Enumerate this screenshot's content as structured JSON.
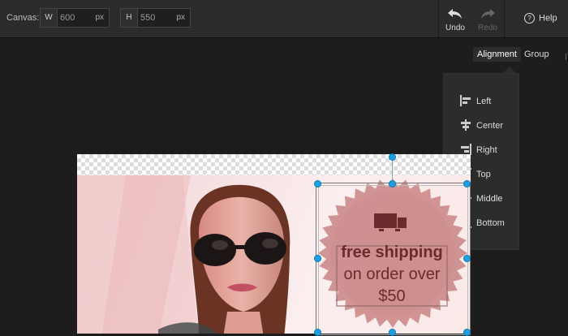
{
  "toolbar": {
    "canvas_label": "Canvas:",
    "width_key": "W",
    "width_value": "600",
    "height_key": "H",
    "height_value": "550",
    "unit": "px",
    "undo_label": "Undo",
    "redo_label": "Redo",
    "help_label": "Help"
  },
  "tabs": {
    "alignment": "Alignment",
    "group": "Group"
  },
  "align_menu": [
    {
      "label": "Left",
      "icon": "align-left-icon"
    },
    {
      "label": "Center",
      "icon": "align-center-icon"
    },
    {
      "label": "Right",
      "icon": "align-right-icon"
    },
    {
      "label": "Top",
      "icon": "align-top-icon"
    },
    {
      "label": "Middle",
      "icon": "align-middle-icon"
    },
    {
      "label": "Bottom",
      "icon": "align-bottom-icon"
    }
  ],
  "banner": {
    "line1": "free shipping",
    "line2": "on order over",
    "line3": "$50",
    "badge_color": "#c98484",
    "text_color": "#6a2b2d",
    "icon": "truck-icon"
  },
  "colors": {
    "toolbar_bg": "#2b2b2a",
    "workspace_bg": "#1d1d1d",
    "handle": "#1ba1e2"
  }
}
